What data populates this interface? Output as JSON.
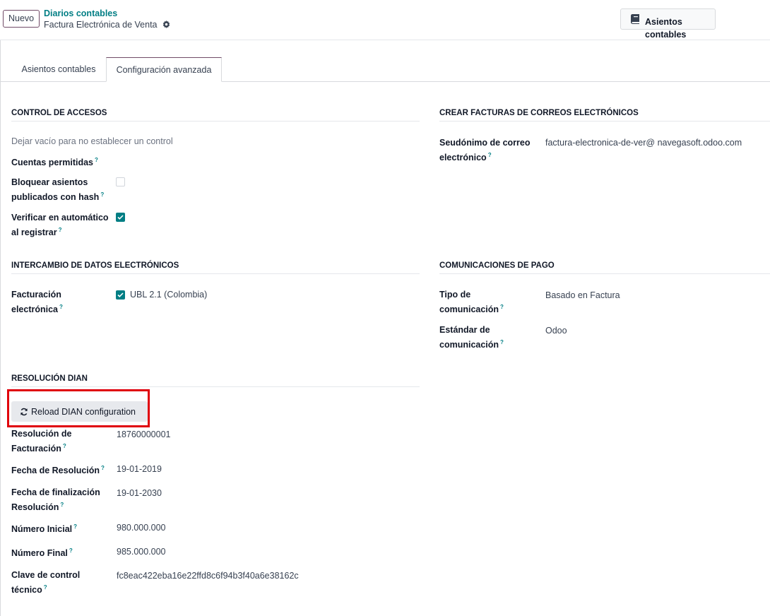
{
  "control_panel": {
    "new_button": "Nuevo",
    "breadcrumb_parent": "Diarios contables",
    "breadcrumb_current": "Factura Electrónica de Venta",
    "smart_button": "Asientos contables"
  },
  "tabs": [
    {
      "label": "Asientos contables",
      "active": false
    },
    {
      "label": "Configuración avanzada",
      "active": true
    }
  ],
  "access_control": {
    "title": "CONTROL DE ACCESOS",
    "placeholder_text": "Dejar vacío para no establecer un control",
    "allowed_accounts": "Cuentas permitidas",
    "lock_hash_label_1": "Bloquear asientos",
    "lock_hash_label_2": "publicados con hash",
    "lock_hash_checked": false,
    "auto_check_label_1": "Verificar en automático",
    "auto_check_label_2": "al registrar",
    "auto_check_checked": true
  },
  "email_invoices": {
    "title": "CREAR FACTURAS DE CORREOS ELECTRÓNICOS",
    "alias_label_1": "Seudónimo de correo",
    "alias_label_2": "electrónico",
    "alias_value": "factura-electronica-de-ver@ navegasoft.odoo.com"
  },
  "edi": {
    "title": "INTERCAMBIO DE DATOS ELECTRÓNICOS",
    "label_1": "Facturación",
    "label_2": "electrónica",
    "option": "UBL 2.1 (Colombia)",
    "checked": true
  },
  "payment_comm": {
    "title": "COMUNICACIONES DE PAGO",
    "type_label_1": "Tipo de",
    "type_label_2": "comunicación",
    "type_value": "Basado en Factura",
    "std_label_1": "Estándar de",
    "std_label_2": "comunicación",
    "std_value": "Odoo"
  },
  "dian": {
    "title": "RESOLUCIÓN DIAN",
    "reload_button": "Reload DIAN configuration",
    "fields": {
      "resolution_label_1": "Resolución de",
      "resolution_label_2": "Facturación",
      "resolution_value": "18760000001",
      "date_label": "Fecha de Resolución",
      "date_value": "19-01-2019",
      "end_label_1": "Fecha de finalización",
      "end_label_2": "Resolución",
      "end_value": "19-01-2030",
      "start_num_label": "Número Inicial",
      "start_num_value": "980.000.000",
      "end_num_label": "Número Final",
      "end_num_value": "985.000.000",
      "key_label_1": "Clave de control",
      "key_label_2": "técnico",
      "key_value": "fc8eac422eba16e22ffd8c6f94b3f40a6e38162c"
    }
  },
  "colors": {
    "brand": "#714b67",
    "accent": "#017e84",
    "highlight": "#e0000b"
  }
}
